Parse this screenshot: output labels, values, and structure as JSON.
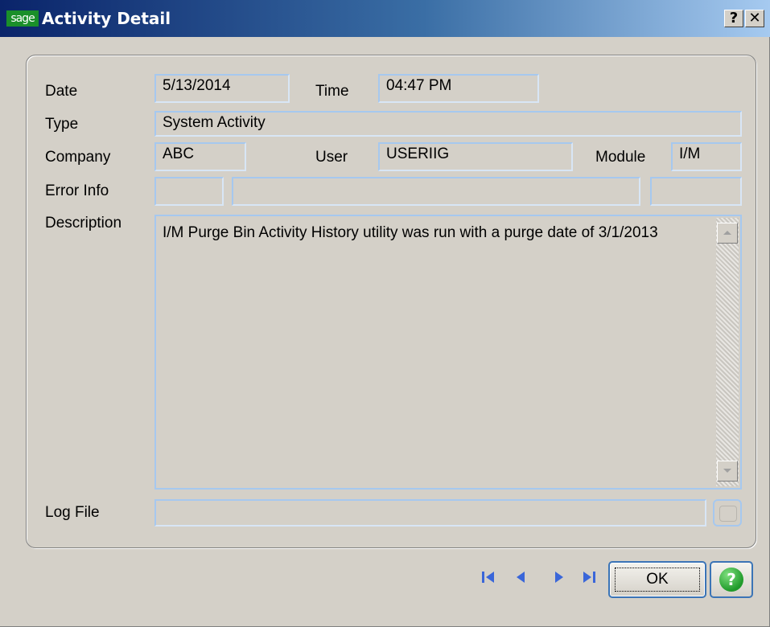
{
  "window": {
    "logo_text": "sage",
    "title": "Activity Detail",
    "help_label": "?",
    "close_label": "✕"
  },
  "form": {
    "date_label": "Date",
    "date_value": "5/13/2014",
    "time_label": "Time",
    "time_value": "04:47 PM",
    "type_label": "Type",
    "type_value": "System Activity",
    "company_label": "Company",
    "company_value": "ABC",
    "user_label": "User",
    "user_value": "USERIIG",
    "module_label": "Module",
    "module_value": "I/M",
    "error_info_label": "Error Info",
    "error_info_values": [
      "",
      "",
      ""
    ],
    "description_label": "Description",
    "description_value": "I/M Purge Bin Activity History utility was run with a purge date of 3/1/2013",
    "log_file_label": "Log File",
    "log_file_value": ""
  },
  "buttons": {
    "ok_label": "OK",
    "help_label": "?"
  },
  "icons": {
    "nav_first": "first-record-icon",
    "nav_prev": "previous-record-icon",
    "nav_next": "next-record-icon",
    "nav_last": "last-record-icon"
  },
  "colors": {
    "title_start": "#0a246a",
    "title_end": "#a6caf0",
    "nav_blue": "#3a66d9",
    "field_border": "#a6c8ef",
    "help_green": "#1f9a2a"
  }
}
